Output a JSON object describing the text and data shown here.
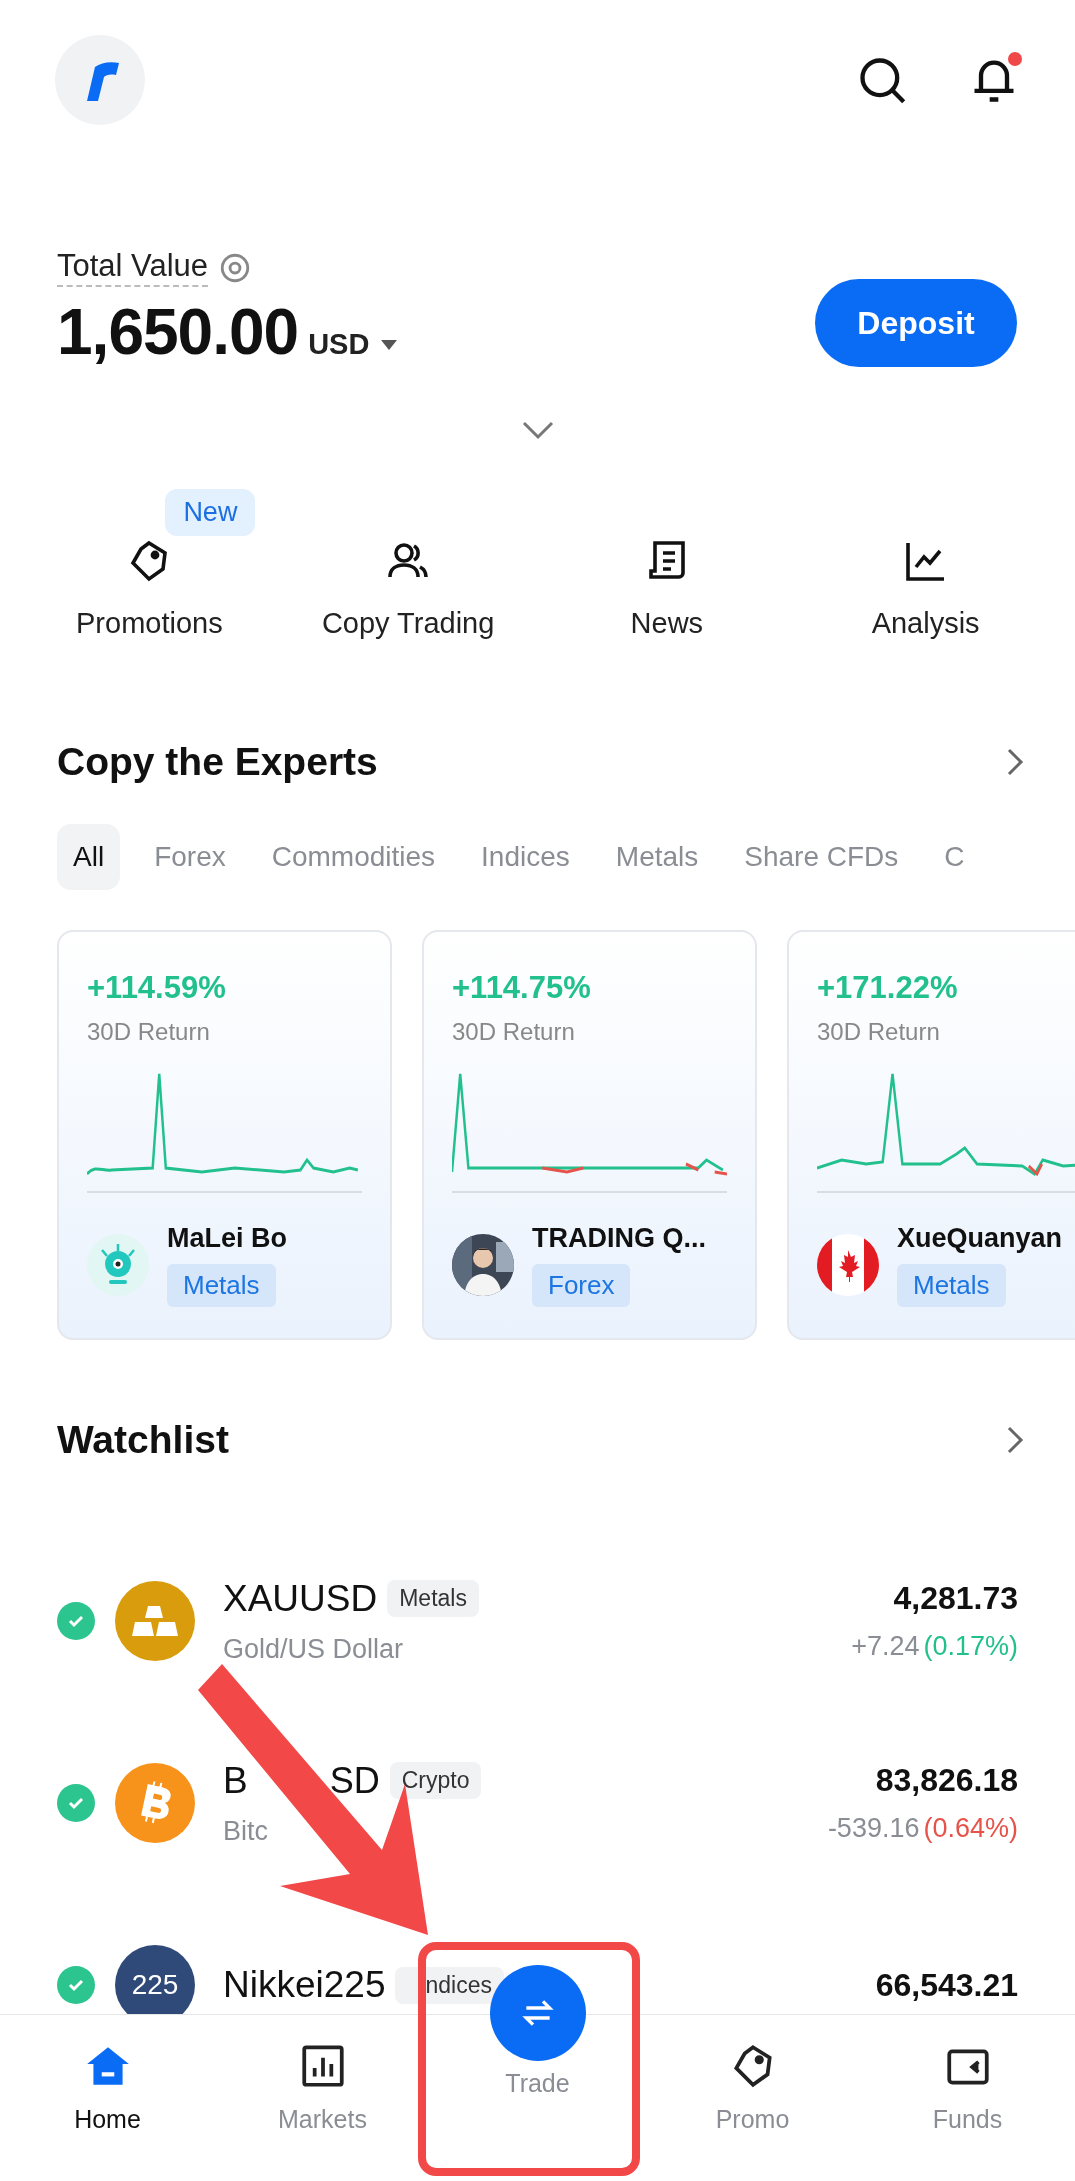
{
  "header": {
    "notification_dot": true
  },
  "balance": {
    "label": "Total Value",
    "amount": "1,650.00",
    "currency": "USD",
    "button": "Deposit"
  },
  "quick_actions": [
    {
      "kind": "tag",
      "label": "Promotions",
      "badge": "New"
    },
    {
      "kind": "people",
      "label": "Copy Trading"
    },
    {
      "kind": "news",
      "label": "News"
    },
    {
      "kind": "chart",
      "label": "Analysis"
    }
  ],
  "experts": {
    "title": "Copy the Experts",
    "tabs": [
      {
        "label": "All",
        "selected": true
      },
      {
        "label": "Forex",
        "selected": false
      },
      {
        "label": "Commodities",
        "selected": false
      },
      {
        "label": "Indices",
        "selected": false
      },
      {
        "label": "Metals",
        "selected": false
      },
      {
        "label": "Share CFDs",
        "selected": false
      },
      {
        "label": "C",
        "selected": false
      }
    ],
    "cards": [
      {
        "return": "+114.59%",
        "return_label": "30D Return",
        "name": "MaLei Bo",
        "tag": "Metals",
        "kind": "robot"
      },
      {
        "return": "+114.75%",
        "return_label": "30D Return",
        "name": "TRADING Q...",
        "tag": "Forex"
      },
      {
        "return": "+171.22%",
        "return_label": "30D Return",
        "name": "XueQuanyan",
        "tag": "Metals",
        "kind": "flag"
      }
    ]
  },
  "watchlist": {
    "title": "Watchlist",
    "rows": [
      {
        "checked": true,
        "kind": "gold",
        "color": "#d89c0c",
        "symbol": "XAUUSD",
        "tag": "Metals",
        "name": "Gold/US Dollar",
        "price": "4,281.73",
        "change": "+7.24",
        "percent": "(0.17%)",
        "positive": true
      },
      {
        "checked": true,
        "kind": "bitcoin",
        "color": "#f7931a",
        "symbol": "B",
        "symbol_tail": "SD",
        "tag": "Crypto",
        "name": "Bitc",
        "price": "83,826.18",
        "change": "-539.16",
        "percent": "(0.64%)",
        "positive": false
      },
      {
        "checked": true,
        "kind": "text",
        "color": "#2f4a78",
        "icon_text": "225",
        "symbol": "Nikkei225",
        "tag": "ndices",
        "price": "66,543.21"
      }
    ]
  },
  "nav": [
    {
      "kind": "home",
      "label": "Home",
      "selected": true
    },
    {
      "kind": "markets",
      "label": "Markets",
      "selected": false
    },
    {
      "kind": "trade",
      "label": "Trade",
      "selected": false
    },
    {
      "kind": "promo",
      "label": "Promo",
      "selected": false
    },
    {
      "kind": "funds",
      "label": "Funds",
      "selected": false
    }
  ],
  "annotation": {
    "arrow": true,
    "highlight": true
  }
}
